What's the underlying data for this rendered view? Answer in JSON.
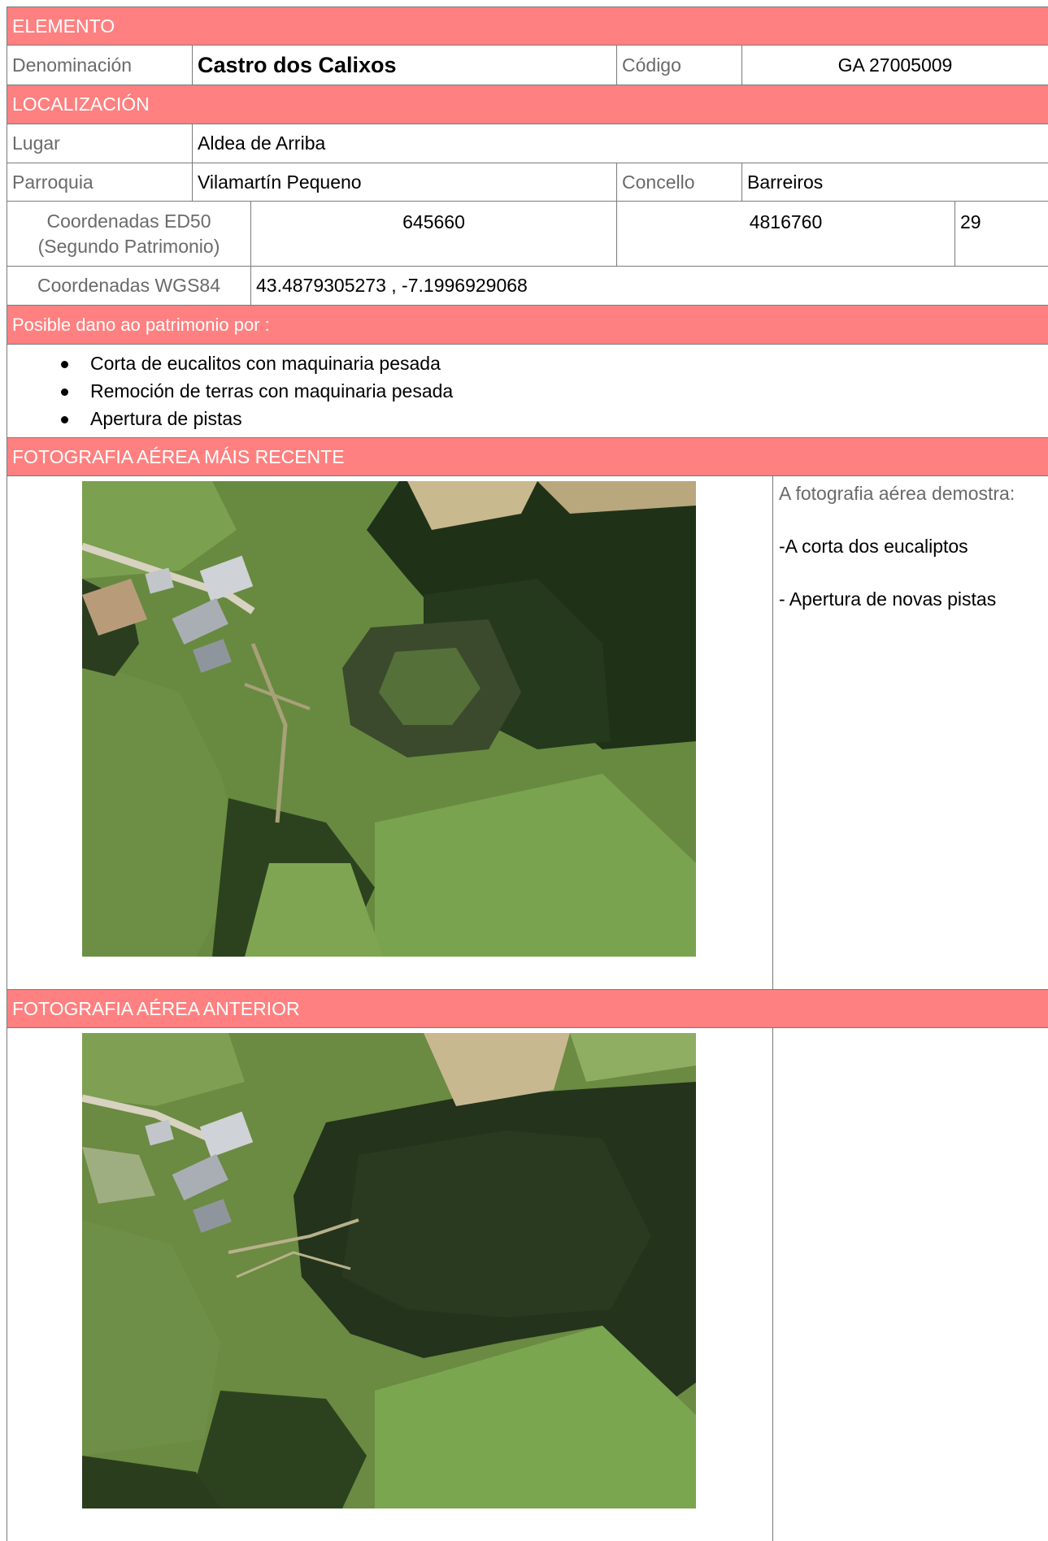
{
  "sections": {
    "elemento": "ELEMENTO",
    "localizacion": "LOCALIZACIÓN",
    "dano": "Posible dano ao patrimonio por :",
    "foto_recente": "FOTOGRAFIA   AÉREA  MÁIS RECENTE",
    "foto_anterior": "FOTOGRAFIA  AÉREA  ANTERIOR"
  },
  "elemento": {
    "denominacion_label": "Denominación",
    "denominacion_value": "Castro dos Calixos",
    "codigo_label": "Código",
    "codigo_value": "GA 27005009"
  },
  "localizacion": {
    "lugar_label": "Lugar",
    "lugar_value": "Aldea de Arriba",
    "parroquia_label": "Parroquia",
    "parroquia_value": "Vilamartín Pequeno",
    "concello_label": "Concello",
    "concello_value": "Barreiros",
    "ed50_label_line1": "Coordenadas ED50",
    "ed50_label_line2": "(Segundo Patrimonio)",
    "ed50_x": "645660",
    "ed50_y": "4816760",
    "ed50_zone": "29",
    "wgs84_label": "Coordenadas WGS84",
    "wgs84_value": "43.4879305273 , -7.1996929068"
  },
  "dano_items": [
    "Corta de eucalitos con maquinaria pesada",
    "Remoción de terras con maquinaria pesada",
    "Apertura de pistas"
  ],
  "foto_recente_notes": {
    "intro": "A fotografia aérea demostra:",
    "item1": "-A corta dos eucaliptos",
    "item2": "- Apertura de novas pistas"
  },
  "colors": {
    "header_bg": "#ff8080",
    "border": "#7a7a7a",
    "label_text": "#6a6a6a"
  }
}
